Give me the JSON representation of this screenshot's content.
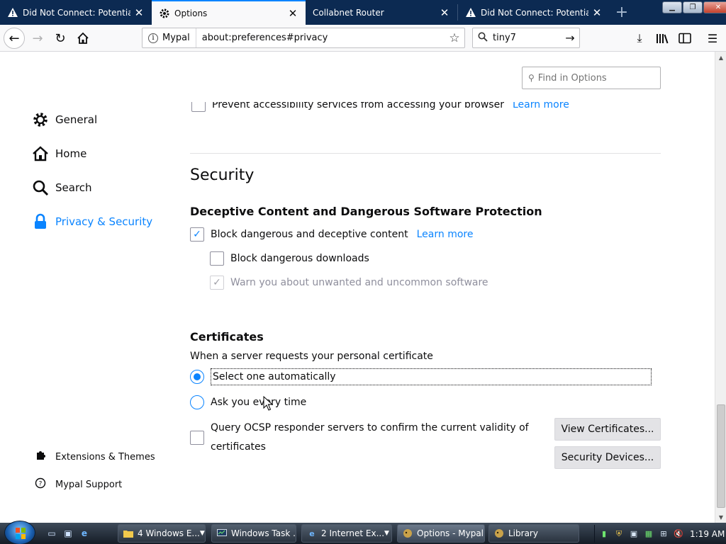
{
  "tabs": [
    {
      "title": "Did Not Connect: Potential Security Issue",
      "icon": "warning-icon",
      "active": false
    },
    {
      "title": "Options",
      "icon": "gear-icon",
      "active": true
    },
    {
      "title": "Collabnet Router",
      "icon": "",
      "active": false
    },
    {
      "title": "Did Not Connect: Potential Security Issue",
      "icon": "warning-icon",
      "active": false
    }
  ],
  "navbar": {
    "identity_label": "Mypal",
    "url": "about:preferences#privacy",
    "search_value": "tiny7"
  },
  "find": {
    "placeholder": "Find in Options"
  },
  "sidebar": {
    "items": [
      {
        "label": "General",
        "icon": "gear-icon"
      },
      {
        "label": "Home",
        "icon": "home-icon"
      },
      {
        "label": "Search",
        "icon": "search-icon"
      },
      {
        "label": "Privacy & Security",
        "icon": "lock-icon"
      }
    ],
    "footer": [
      {
        "label": "Extensions & Themes",
        "icon": "puzzle-icon"
      },
      {
        "label": "Mypal Support",
        "icon": "help-icon"
      }
    ]
  },
  "clipped_row": {
    "label": "Prevent accessibility services from accessing your browser",
    "link": "Learn more"
  },
  "security": {
    "title": "Security",
    "deceptive": {
      "title": "Deceptive Content and Dangerous Software Protection",
      "block_label": "Block dangerous and deceptive content",
      "learn_more": "Learn more",
      "downloads_label": "Block dangerous downloads",
      "unwanted_label": "Warn you about unwanted and uncommon software"
    },
    "certificates": {
      "title": "Certificates",
      "prompt": "When a server requests your personal certificate",
      "select_auto": "Select one automatically",
      "ask_every": "Ask you every time",
      "ocsp_line1": "Query OCSP responder servers to confirm the current validity of",
      "ocsp_line2": "certificates",
      "view_certs_button": "View Certificates...",
      "security_devices_button": "Security Devices..."
    }
  },
  "taskbar": {
    "tasks": [
      {
        "label": "4 Windows E...",
        "icon": "folder-icon"
      },
      {
        "label": "Windows Task ...",
        "icon": "task-manager-icon"
      },
      {
        "label": "2 Internet Ex...",
        "icon": "ie-icon"
      },
      {
        "label": "Options - Mypal",
        "icon": "mypal-icon"
      },
      {
        "label": "Library",
        "icon": "mypal-icon"
      }
    ],
    "clock": "1:19 AM"
  },
  "colors": {
    "accent": "#0a84ff",
    "tabstrip": "#0c2a52"
  }
}
